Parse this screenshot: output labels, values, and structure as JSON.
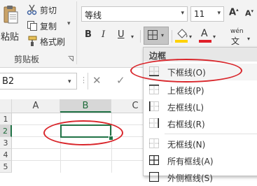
{
  "clipboard": {
    "paste_label": "粘贴",
    "cut_label": "剪切",
    "copy_label": "复制",
    "format_painter_label": "格式刷",
    "group_label": "剪贴板"
  },
  "font": {
    "name": "等线",
    "size": "11",
    "grow_label": "A",
    "shrink_label": "A",
    "bold_label": "B",
    "italic_label": "I",
    "underline_label": "U",
    "font_color_label": "A",
    "phonetic_top": "wén",
    "phonetic_label": "文",
    "fill_color": "#ffd200",
    "font_color": "#e0202a"
  },
  "formula_bar": {
    "name_box": "B2",
    "dots": "⋮",
    "cancel_label": "✕",
    "enter_label": "✓"
  },
  "sheet": {
    "columns": [
      "A",
      "B",
      "C"
    ],
    "rows": [
      "1",
      "2",
      "3",
      "4",
      "5"
    ],
    "selected_cell": "B2"
  },
  "border_menu": {
    "title": "边框",
    "items": [
      {
        "label": "下框线(O)",
        "icon": "bottom-border-icon"
      },
      {
        "label": "上框线(P)",
        "icon": "top-border-icon"
      },
      {
        "label": "左框线(L)",
        "icon": "left-border-icon"
      },
      {
        "label": "右框线(R)",
        "icon": "right-border-icon"
      },
      {
        "label": "无框线(N)",
        "icon": "no-border-icon"
      },
      {
        "label": "所有框线(A)",
        "icon": "all-borders-icon"
      },
      {
        "label": "外侧框线(S)",
        "icon": "outside-borders-icon"
      }
    ]
  },
  "colors": {
    "accent": "#217346",
    "annotation": "#d9262b"
  }
}
